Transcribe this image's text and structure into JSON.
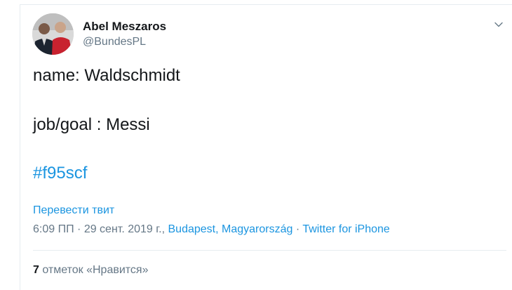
{
  "author": {
    "name": "Abel Meszaros",
    "handle": "@BundesPL",
    "avatar_icon": "avatar-photo"
  },
  "menu": {
    "icon": "chevron-down-icon"
  },
  "tweet": {
    "line1": "name: Waldschmidt",
    "line2": "job/goal : Messi",
    "hashtag": "#f95scf"
  },
  "translate_label": "Перевести твит",
  "meta": {
    "time": "6:09 ПП",
    "sep1": " · ",
    "date": "29 сент. 2019 г.,",
    "location": "Budapest, Magyarország",
    "sep2": " · ",
    "source": "Twitter for iPhone"
  },
  "likes": {
    "count": "7",
    "label": "отметок «Нравится»"
  },
  "colors": {
    "link": "#1b95e0",
    "secondary_text": "#657786",
    "primary_text": "#14171a"
  }
}
